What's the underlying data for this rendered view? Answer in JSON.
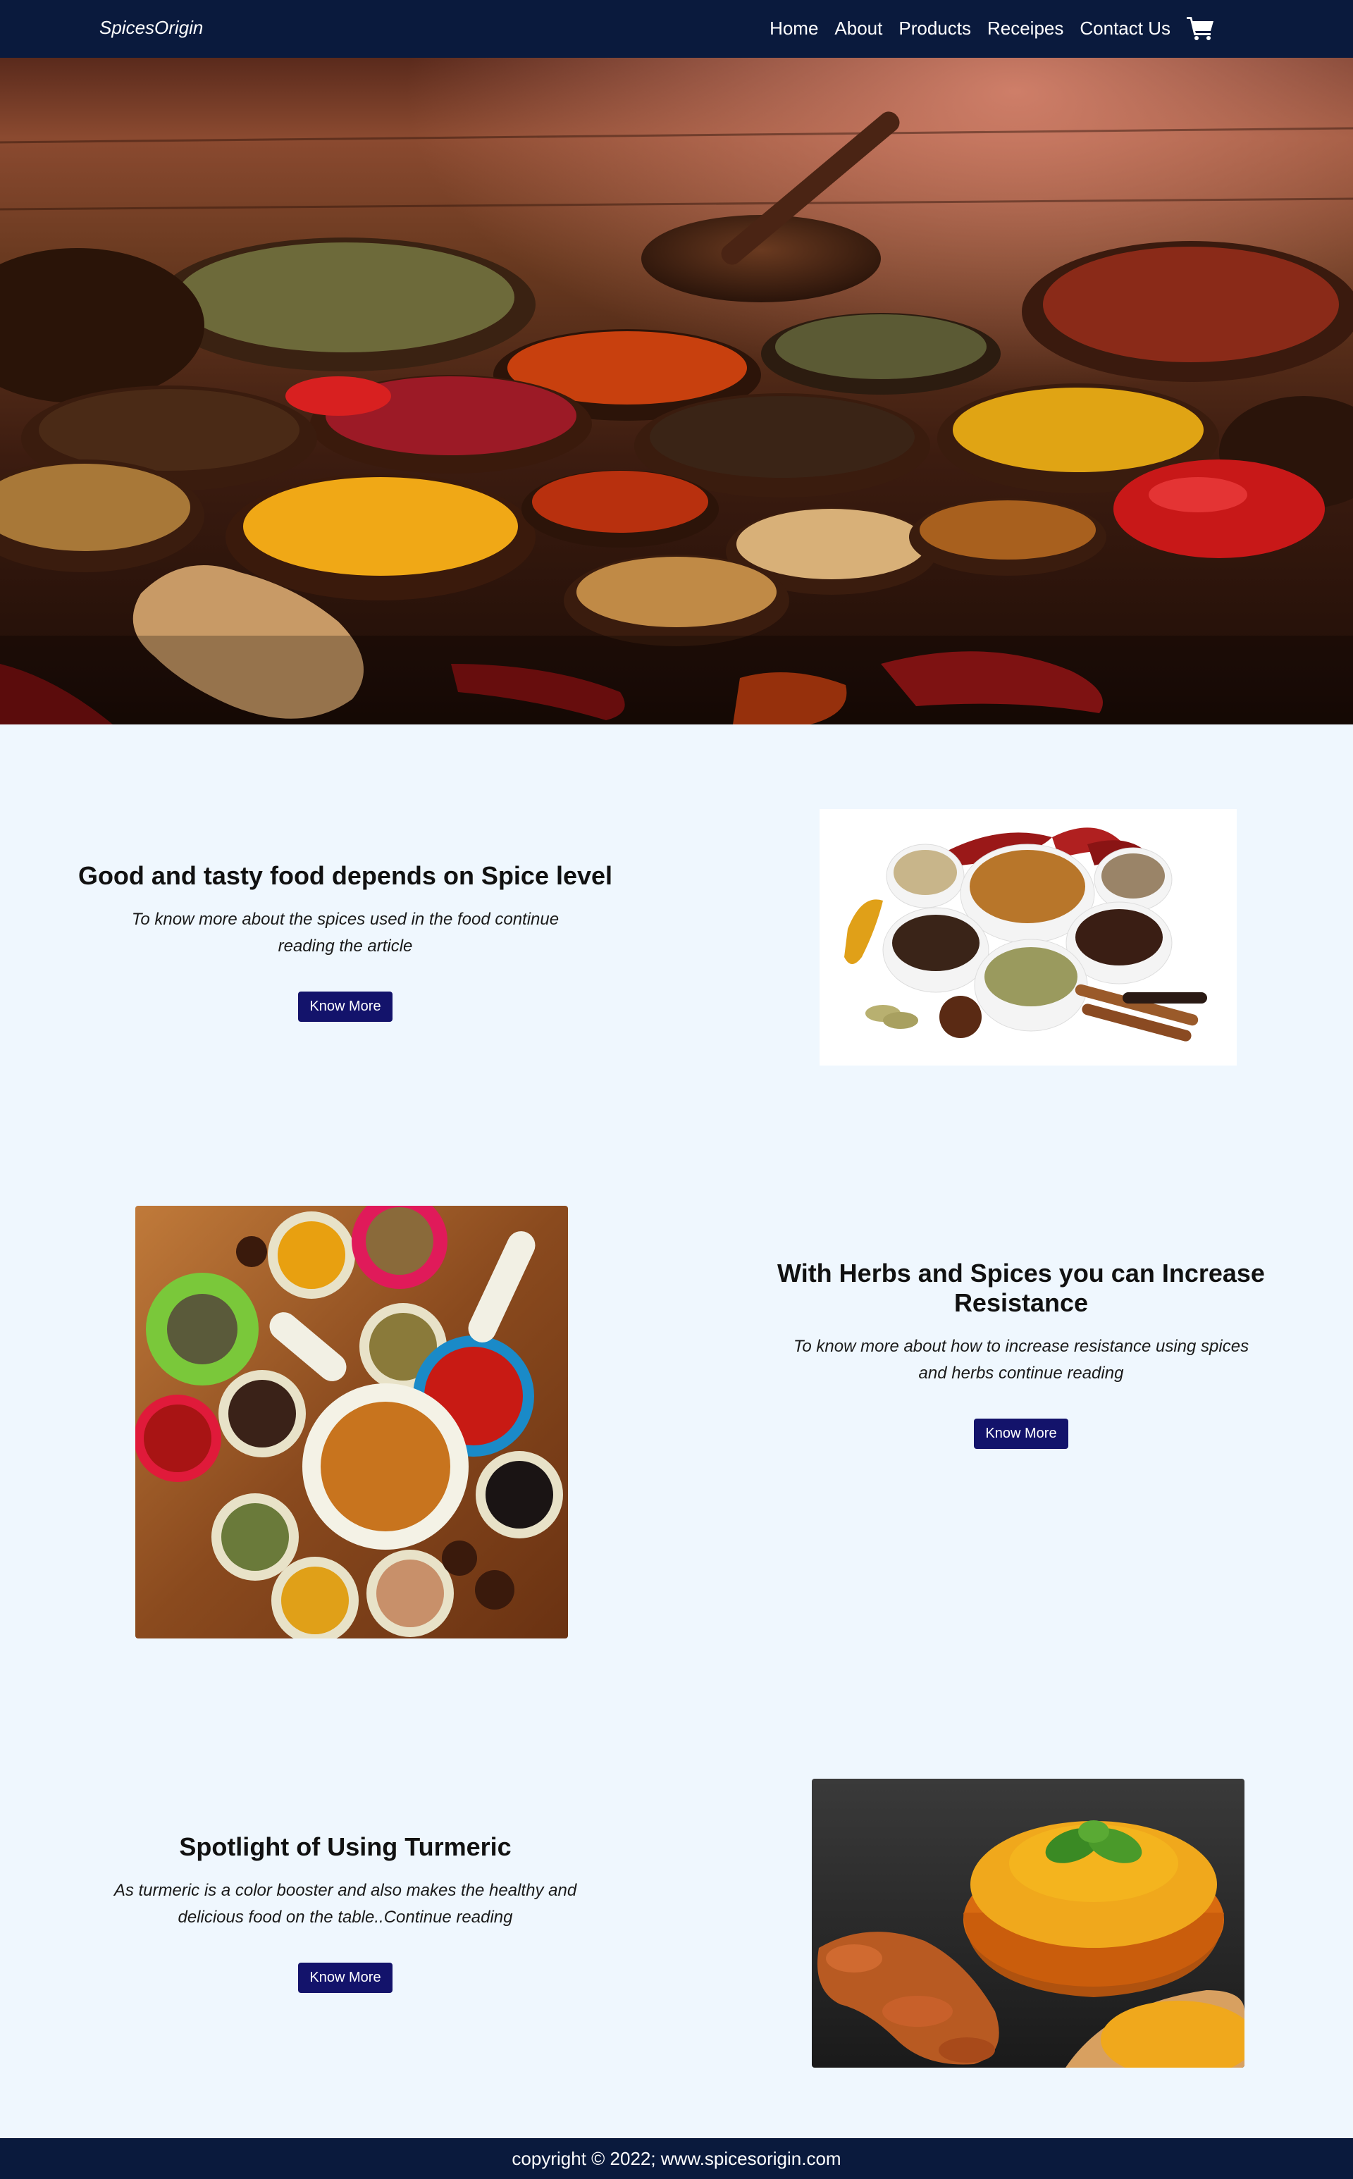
{
  "nav": {
    "brand": "SpicesOrigin",
    "links": [
      "Home",
      "About",
      "Products",
      "Receipes",
      "Contact Us"
    ],
    "cart_icon": "shopping-cart-icon"
  },
  "sections": [
    {
      "heading": "Good and tasty food depends on Spice level",
      "desc_line1": "To know more about the spices used in the food continue",
      "desc_line2": "reading the article",
      "button": "Know More"
    },
    {
      "heading": "With Herbs and Spices you can Increase Resistance",
      "desc_line1": "To know more about how to increase resistance using spices",
      "desc_line2": "and herbs continue reading",
      "button": "Know More"
    },
    {
      "heading": "Spotlight of Using Turmeric",
      "desc_line1": "As turmeric is a color booster and also makes the healthy and",
      "desc_line2": "delicious food on the table..Continue reading",
      "button": "Know More"
    }
  ],
  "footer": {
    "text": "copyright © 2022; www.spicesorigin.com"
  },
  "colors": {
    "navbar_bg": "#0a1a3d",
    "page_bg": "#eff7fe",
    "button_bg": "#13136b"
  }
}
